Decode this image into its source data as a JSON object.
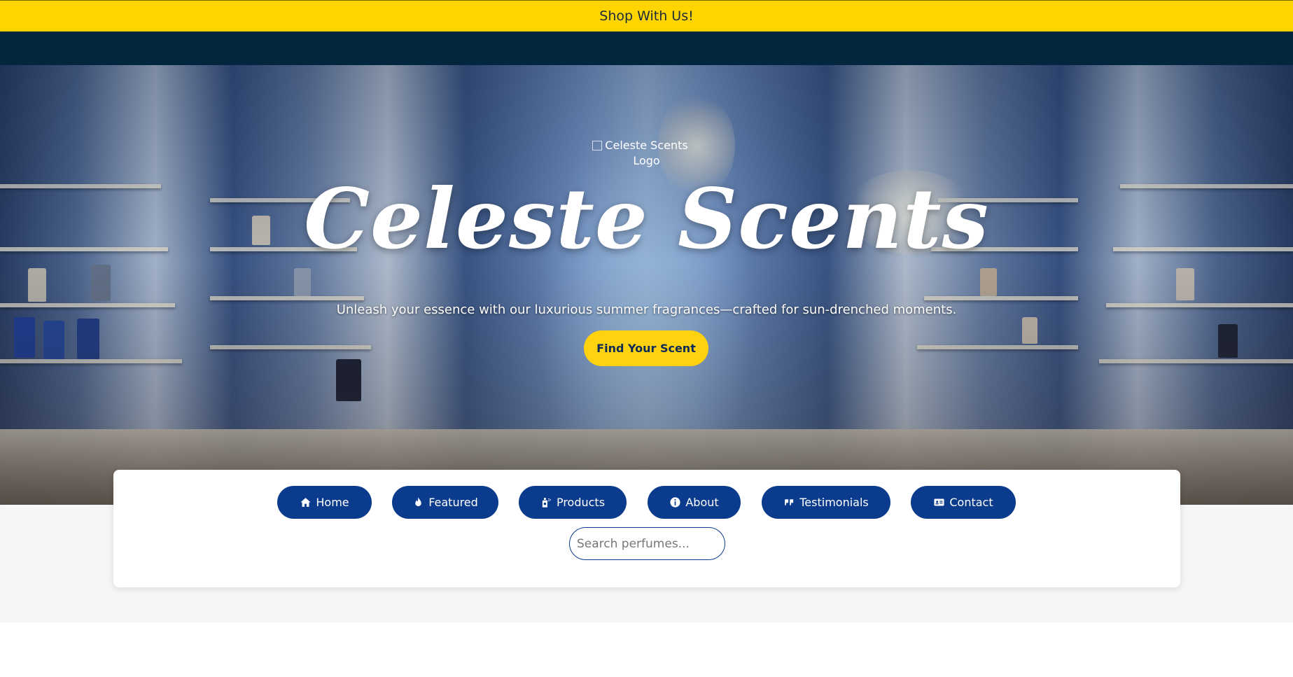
{
  "announcement": {
    "text": "Shop With Us!"
  },
  "hero": {
    "logo_alt": "Celeste Scents Logo",
    "title": "Celeste Scents",
    "tagline": "Unleash your essence with our luxurious summer fragrances—crafted for sun-drenched moments.",
    "cta_label": "Find Your Scent"
  },
  "nav": {
    "items": [
      {
        "label": "Home",
        "icon": "home-icon"
      },
      {
        "label": "Featured",
        "icon": "fire-icon"
      },
      {
        "label": "Products",
        "icon": "spray-bottle-icon"
      },
      {
        "label": "About",
        "icon": "info-icon"
      },
      {
        "label": "Testimonials",
        "icon": "quote-icon"
      },
      {
        "label": "Contact",
        "icon": "id-card-icon"
      }
    ]
  },
  "search": {
    "placeholder": "Search perfumes..."
  },
  "colors": {
    "announce_bg": "#ffd500",
    "top_nav_bg": "#02263d",
    "primary": "#0b3b8c",
    "cta": "#ffd20f"
  }
}
